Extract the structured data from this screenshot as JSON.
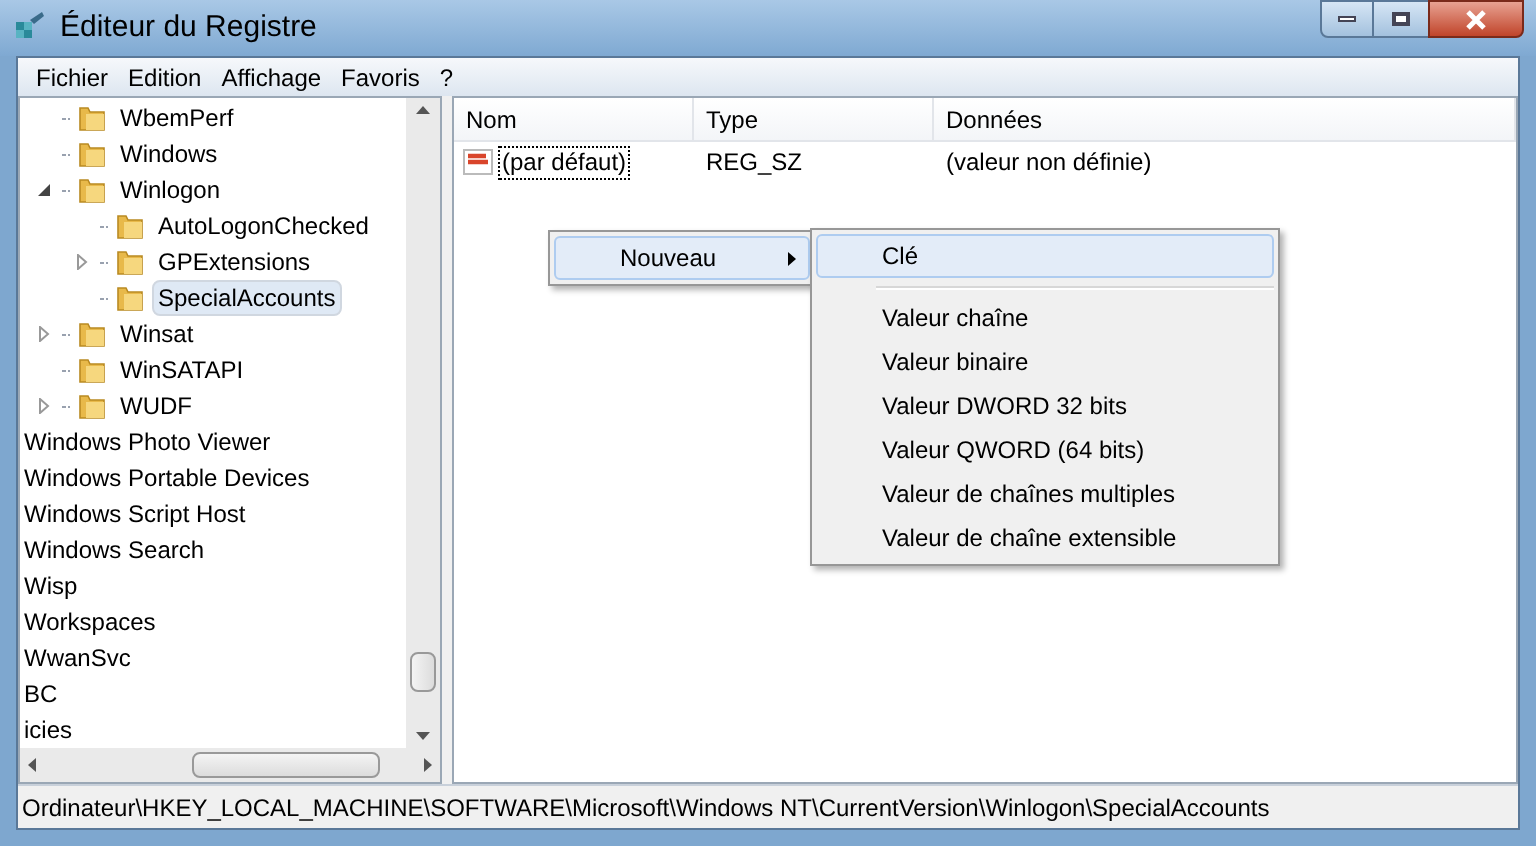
{
  "window": {
    "title": "Éditeur du Registre"
  },
  "menu_bar": [
    "Fichier",
    "Edition",
    "Affichage",
    "Favoris",
    "?"
  ],
  "tree": {
    "inner_items": [
      {
        "label": "WbemPerf",
        "selected": false
      },
      {
        "label": "Windows",
        "selected": false
      },
      {
        "label": "Winlogon",
        "expanded": true,
        "selected": false,
        "children": [
          {
            "label": "AutoLogonChecked",
            "selected": false
          },
          {
            "label": "GPExtensions",
            "expanded": false,
            "selected": false
          },
          {
            "label": "SpecialAccounts",
            "selected": true
          }
        ]
      },
      {
        "label": "Winsat",
        "expanded": false,
        "selected": false
      },
      {
        "label": "WinSATAPI",
        "selected": false
      },
      {
        "label": "WUDF",
        "expanded": false,
        "selected": false
      }
    ],
    "outer_items": [
      "Windows Photo Viewer",
      "Windows Portable Devices",
      "Windows Script Host",
      "Windows Search",
      "Wisp",
      "Workspaces",
      "WwanSvc",
      "BC",
      "icies"
    ]
  },
  "values": {
    "columns": [
      "Nom",
      "Type",
      "Données"
    ],
    "rows": [
      {
        "name": "(par défaut)",
        "type": "REG_SZ",
        "data": "(valeur non définie)"
      }
    ]
  },
  "context_menu": {
    "items": [
      {
        "label": "Nouveau",
        "selected": true,
        "submenu": true
      }
    ]
  },
  "submenu": {
    "items": [
      {
        "kind": "item",
        "label": "Clé",
        "selected": true
      },
      {
        "kind": "separator"
      },
      {
        "kind": "item",
        "label": "Valeur chaîne",
        "selected": false
      },
      {
        "kind": "item",
        "label": "Valeur binaire",
        "selected": false
      },
      {
        "kind": "item",
        "label": "Valeur DWORD 32 bits",
        "selected": false
      },
      {
        "kind": "item",
        "label": "Valeur QWORD (64 bits)",
        "selected": false
      },
      {
        "kind": "item",
        "label": "Valeur de chaînes multiples",
        "selected": false
      },
      {
        "kind": "item",
        "label": "Valeur de chaîne extensible",
        "selected": false
      }
    ]
  },
  "status_bar": "Ordinateur\\HKEY_LOCAL_MACHINE\\SOFTWARE\\Microsoft\\Windows NT\\CurrentVersion\\Winlogon\\SpecialAccounts"
}
